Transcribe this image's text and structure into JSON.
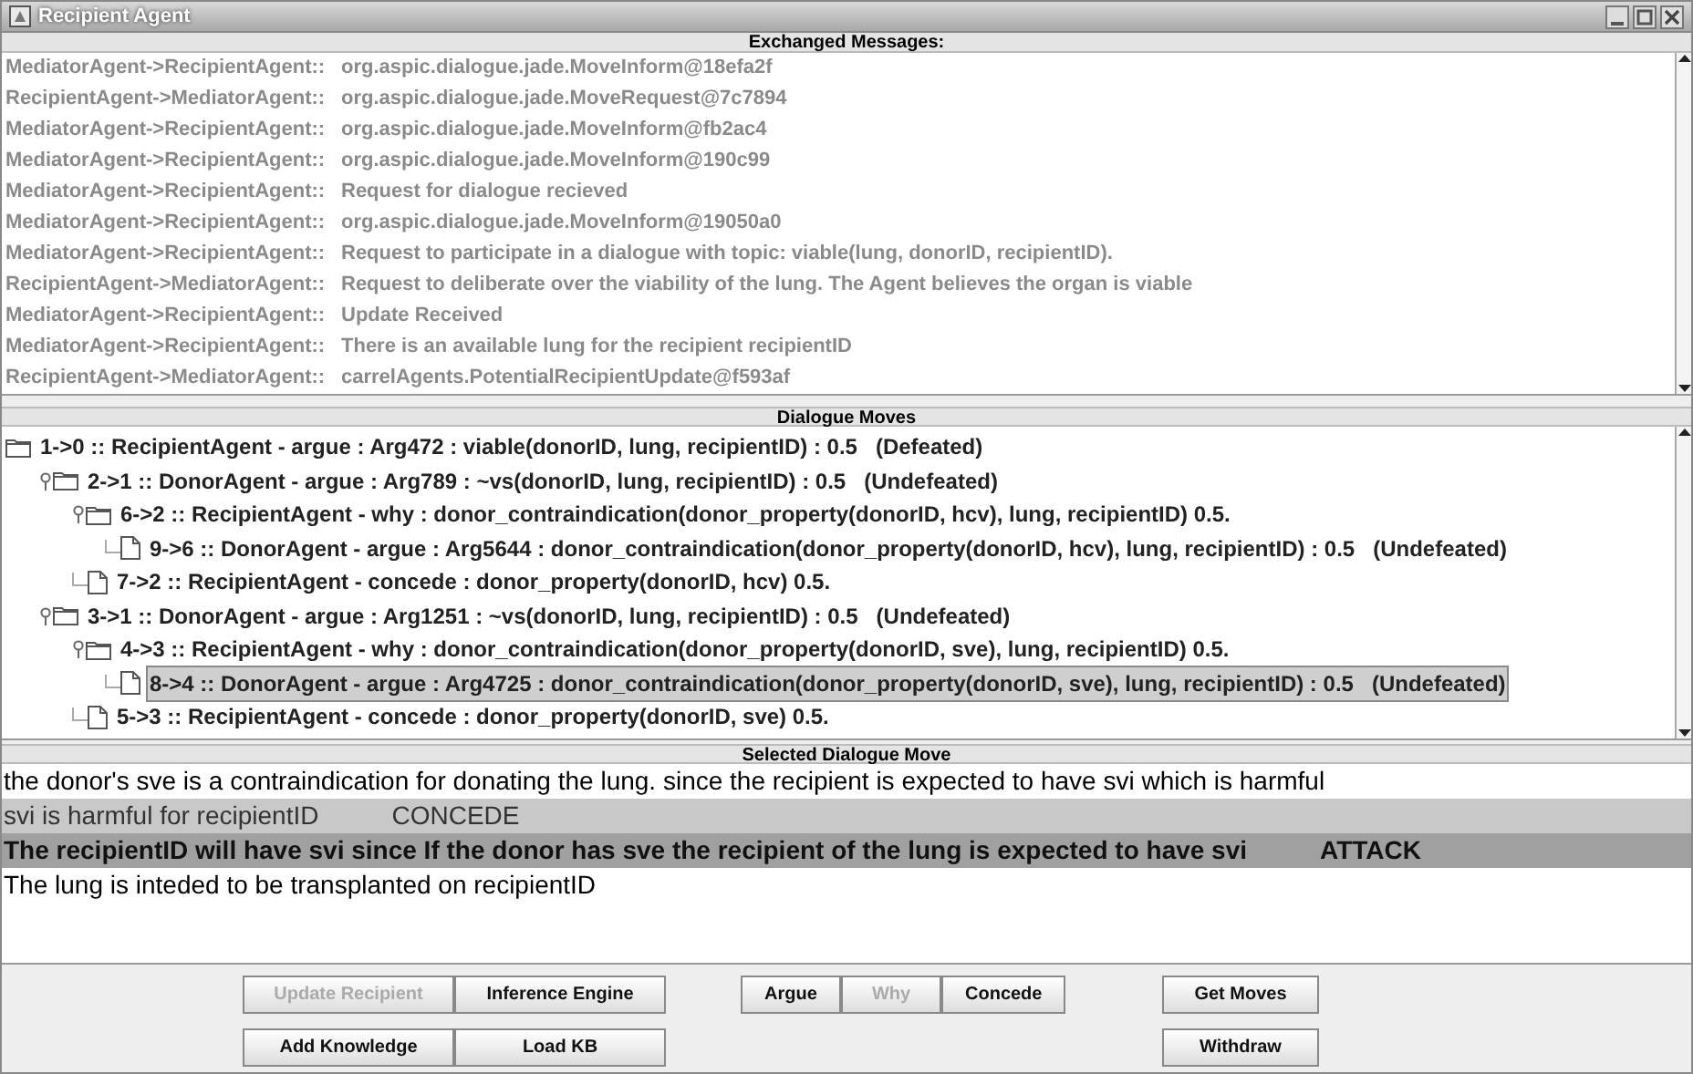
{
  "window": {
    "title": "Recipient Agent"
  },
  "exchanged_messages": {
    "header": "Exchanged Messages:",
    "messages": [
      {
        "sender": "MediatorAgent->RecipientAgent::",
        "text": "org.aspic.dialogue.jade.MoveInform@18efa2f"
      },
      {
        "sender": "RecipientAgent->MediatorAgent::",
        "text": "org.aspic.dialogue.jade.MoveRequest@7c7894"
      },
      {
        "sender": "MediatorAgent->RecipientAgent::",
        "text": "org.aspic.dialogue.jade.MoveInform@fb2ac4"
      },
      {
        "sender": "MediatorAgent->RecipientAgent::",
        "text": "org.aspic.dialogue.jade.MoveInform@190c99"
      },
      {
        "sender": "MediatorAgent->RecipientAgent::",
        "text": "Request for dialogue recieved"
      },
      {
        "sender": "MediatorAgent->RecipientAgent::",
        "text": "org.aspic.dialogue.jade.MoveInform@19050a0"
      },
      {
        "sender": "MediatorAgent->RecipientAgent::",
        "text": "Request to participate in a dialogue with topic: viable(lung, donorID, recipientID)."
      },
      {
        "sender": "RecipientAgent->MediatorAgent::",
        "text": "Request to deliberate over the viability of the lung. The Agent believes the organ is viable"
      },
      {
        "sender": "MediatorAgent->RecipientAgent::",
        "text": "Update Received"
      },
      {
        "sender": "MediatorAgent->RecipientAgent::",
        "text": "There is an available lung for the recipient recipientID"
      },
      {
        "sender": "RecipientAgent->MediatorAgent::",
        "text": "carrelAgents.PotentialRecipientUpdate@f593af"
      }
    ]
  },
  "dialogue_moves": {
    "header": "Dialogue Moves",
    "tree": [
      {
        "label": "1->0 :: RecipientAgent - argue : Arg472 : viable(donorID, lung, recipientID) : 0.5",
        "status": "(Defeated)",
        "kind": "folder",
        "expanded": true,
        "selected": false,
        "children": [
          {
            "label": "2->1 :: DonorAgent - argue : Arg789 : ~vs(donorID, lung, recipientID) : 0.5",
            "status": "(Undefeated)",
            "kind": "folder",
            "expanded": true,
            "selected": false,
            "children": [
              {
                "label": "6->2 :: RecipientAgent - why : donor_contraindication(donor_property(donorID, hcv), lung, recipientID) 0.5.",
                "kind": "folder",
                "expanded": true,
                "selected": false,
                "children": [
                  {
                    "label": "9->6 :: DonorAgent - argue : Arg5644 : donor_contraindication(donor_property(donorID, hcv), lung, recipientID) : 0.5",
                    "status": "(Undefeated)",
                    "kind": "leaf",
                    "selected": false
                  }
                ]
              },
              {
                "label": "7->2 :: RecipientAgent - concede : donor_property(donorID, hcv) 0.5.",
                "kind": "leaf",
                "selected": false
              }
            ]
          },
          {
            "label": "3->1 :: DonorAgent - argue : Arg1251 : ~vs(donorID, lung, recipientID) : 0.5",
            "status": "(Undefeated)",
            "kind": "folder",
            "expanded": true,
            "selected": false,
            "children": [
              {
                "label": "4->3 :: RecipientAgent - why : donor_contraindication(donor_property(donorID, sve), lung, recipientID) 0.5.",
                "kind": "folder",
                "expanded": true,
                "selected": false,
                "children": [
                  {
                    "label": "8->4 :: DonorAgent - argue : Arg4725 : donor_contraindication(donor_property(donorID, sve), lung, recipientID) : 0.5",
                    "status": "(Undefeated)",
                    "kind": "leaf",
                    "selected": true
                  }
                ]
              },
              {
                "label": "5->3 :: RecipientAgent - concede : donor_property(donorID, sve) 0.5.",
                "kind": "leaf",
                "selected": false
              }
            ]
          }
        ]
      }
    ]
  },
  "selected_dialogue_move": {
    "header": "Selected Dialogue Move",
    "lines": [
      {
        "text": "the donor's sve is a contraindication for donating the lung. since the recipient is expected to have svi which is harmful",
        "kind": "plain"
      },
      {
        "text": "svi is harmful for recipientID",
        "tag": "CONCEDE",
        "kind": "concede"
      },
      {
        "text": "The recipientID will have svi since If the donor has sve the recipient of the lung is expected to have svi",
        "tag": "ATTACK",
        "kind": "attack"
      },
      {
        "text": "The lung is inteded to be transplanted on recipientID",
        "kind": "plain"
      }
    ]
  },
  "button_rows": [
    {
      "left": [
        {
          "label": "Update Recipient",
          "disabled": true
        },
        {
          "label": "Inference Engine",
          "disabled": false
        }
      ],
      "middle": [
        {
          "label": "Argue",
          "disabled": false
        },
        {
          "label": "Why",
          "disabled": true
        },
        {
          "label": "Concede",
          "disabled": false
        }
      ],
      "right": [
        {
          "label": "Get Moves",
          "disabled": false
        }
      ]
    },
    {
      "left": [
        {
          "label": "Add Knowledge",
          "disabled": false
        },
        {
          "label": "Load KB",
          "disabled": false
        }
      ],
      "right": [
        {
          "label": "Withdraw",
          "disabled": false
        }
      ]
    }
  ]
}
